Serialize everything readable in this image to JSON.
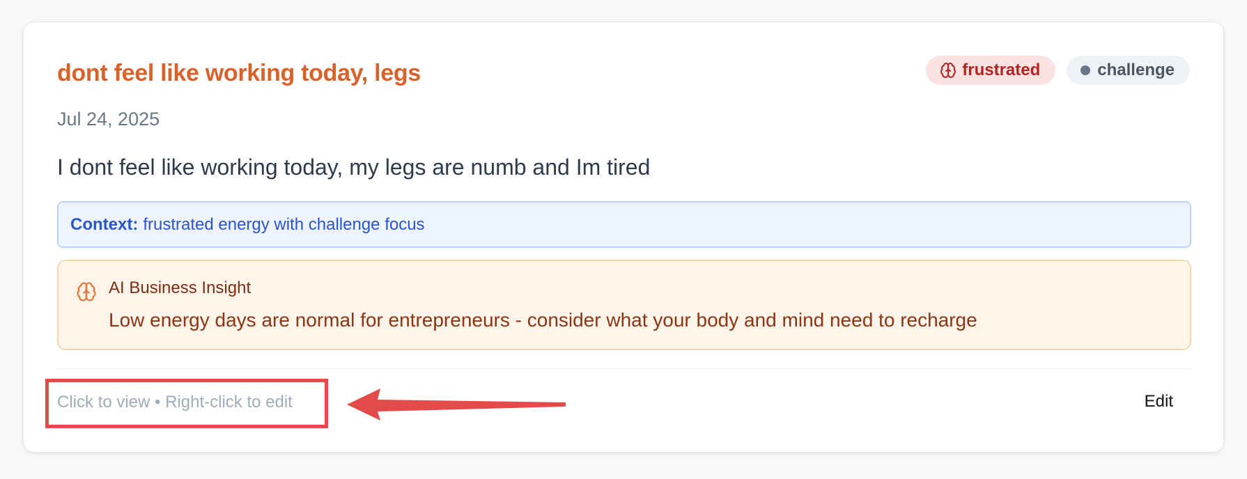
{
  "entry": {
    "title": "dont feel like working today, legs",
    "date": "Jul 24, 2025",
    "text": "I dont feel like working today, my legs are numb and Im tired",
    "tags": {
      "mood": {
        "label": "frustrated",
        "icon": "brain-icon",
        "color": "#b42323",
        "background": "#fbe2e2"
      },
      "category": {
        "label": "challenge",
        "icon": "dot-icon",
        "color": "#4b5563",
        "background": "#eef1f5"
      }
    },
    "context": {
      "label": "Context:",
      "text": "frustrated energy with challenge focus"
    },
    "insight": {
      "icon": "brain-icon",
      "title": "AI Business Insight",
      "text": "Low energy days are normal for entrepreneurs - consider what your body and mind need to recharge"
    },
    "footer": {
      "hint": "Click to view • Right-click to edit",
      "edit_label": "Edit"
    }
  },
  "annotation": {
    "color": "#e44a4a",
    "target": "footer-hint"
  },
  "colors": {
    "title": "#d9622b",
    "background": "#f7f8fa",
    "card": "#ffffff"
  }
}
